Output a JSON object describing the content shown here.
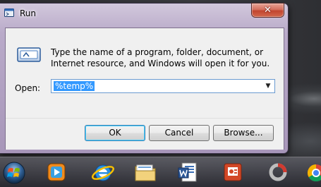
{
  "window": {
    "title": "Run",
    "close_glyph": "✕",
    "description": "Type the name of a program, folder, document, or Internet resource, and Windows will open it for you.",
    "open_label": "Open:",
    "open_value": "%temp%",
    "dropdown_glyph": "▼",
    "buttons": {
      "ok": "OK",
      "cancel": "Cancel",
      "browse": "Browse..."
    }
  },
  "icons": {
    "app": "run-icon",
    "close": "close-icon",
    "dropdown": "chevron-down-icon"
  },
  "taskbar": {
    "items": [
      {
        "name": "start-button",
        "icon": "windows-orb-icon"
      },
      {
        "name": "media-player",
        "icon": "media-player-icon"
      },
      {
        "name": "internet-explorer",
        "icon": "internet-explorer-icon"
      },
      {
        "name": "file-explorer",
        "icon": "folder-icon"
      },
      {
        "name": "word",
        "icon": "word-icon"
      },
      {
        "name": "powerpoint",
        "icon": "powerpoint-icon"
      },
      {
        "name": "app-ring",
        "icon": "ring-app-icon"
      },
      {
        "name": "chrome",
        "icon": "chrome-icon"
      }
    ]
  },
  "colors": {
    "selection": "#3399ff",
    "close_button": "#c2452f",
    "frame": "#b9aac9"
  }
}
